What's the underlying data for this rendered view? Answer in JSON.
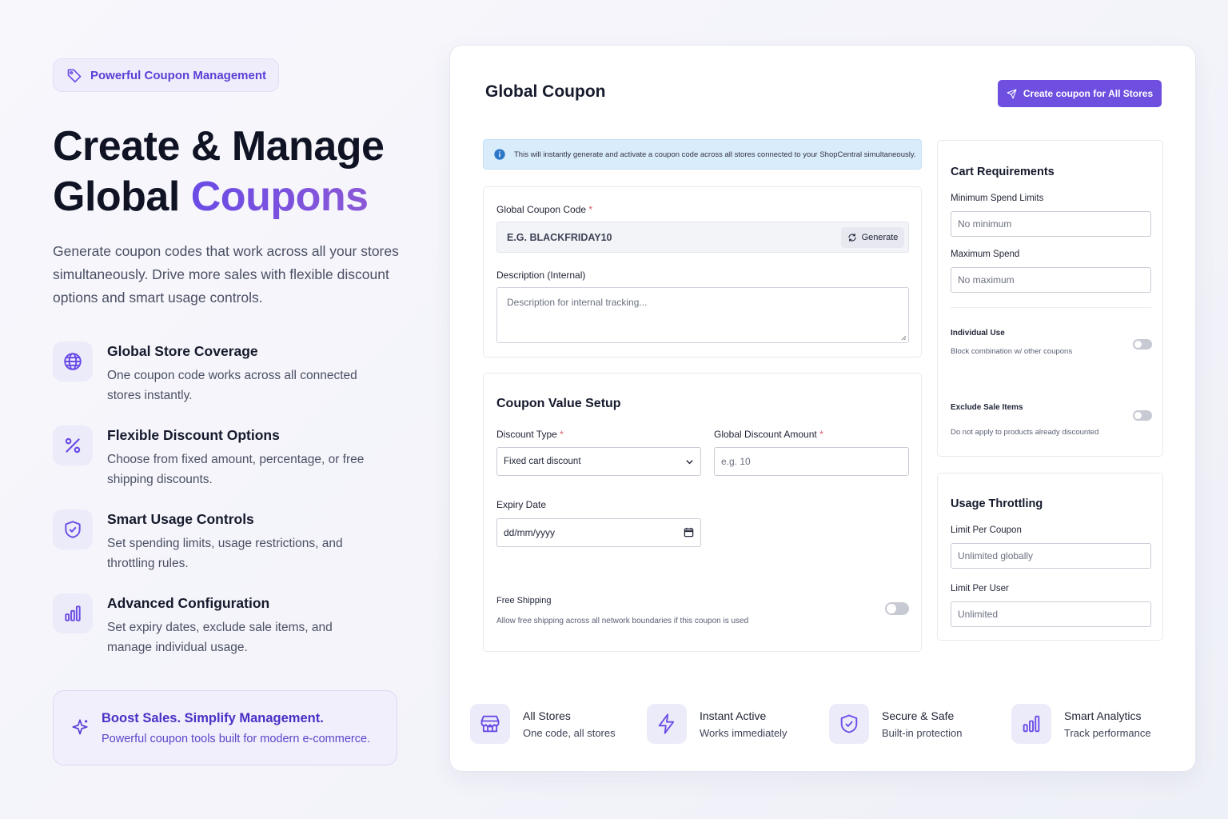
{
  "left": {
    "pill": "Powerful Coupon Management",
    "hero_line1": "Create & Manage",
    "hero_line2_plain": "Global ",
    "hero_line2_accent": "Coupons",
    "lead": "Generate coupon codes that work across all your stores simultaneously. Drive more sales with flexible discount options and smart usage controls.",
    "features": [
      {
        "icon": "globe-icon",
        "title": "Global Store Coverage",
        "desc": "One coupon code works across all connected stores instantly."
      },
      {
        "icon": "percent-icon",
        "title": "Flexible Discount Options",
        "desc": "Choose from fixed amount, percentage, or free shipping discounts."
      },
      {
        "icon": "shield-check-icon",
        "title": "Smart Usage Controls",
        "desc": "Set spending limits, usage restrictions, and throttling rules."
      },
      {
        "icon": "bar-chart-icon",
        "title": "Advanced Configuration",
        "desc": "Set expiry dates, exclude sale items, and manage individual usage."
      }
    ],
    "boost_title": "Boost Sales. Simplify Management.",
    "boost_sub": "Powerful coupon tools built for modern e-commerce."
  },
  "card": {
    "title": "Global Coupon",
    "create_button": "Create coupon for All Stores",
    "info": "This will instantly generate and activate a coupon code across all stores connected to your ShopCentral simultaneously.",
    "coupon_code_label": "Global Coupon Code",
    "coupon_code_placeholder": "E.G. BLACKFRIDAY10",
    "generate_button": "Generate",
    "description_label": "Description (Internal)",
    "description_placeholder": "Description for internal tracking...",
    "value_setup_title": "Coupon Value Setup",
    "discount_type_label": "Discount Type",
    "discount_type_value": "Fixed cart discount",
    "discount_amount_label": "Global Discount Amount",
    "discount_amount_placeholder": "e.g. 10",
    "expiry_label": "Expiry Date",
    "expiry_placeholder": "dd/mm/yyyy",
    "free_shipping_title": "Free Shipping",
    "free_shipping_desc": "Allow free shipping across all network boundaries if this coupon is used",
    "required_mark": "*"
  },
  "cart": {
    "title": "Cart Requirements",
    "min_label": "Minimum Spend Limits",
    "min_placeholder": "No minimum",
    "max_label": "Maximum Spend",
    "max_placeholder": "No maximum",
    "individual_title": "Individual Use",
    "individual_desc": "Block combination w/ other coupons",
    "exclude_title": "Exclude Sale Items",
    "exclude_desc": "Do not apply to products already discounted"
  },
  "usage": {
    "title": "Usage Throttling",
    "per_coupon_label": "Limit Per Coupon",
    "per_coupon_placeholder": "Unlimited globally",
    "per_user_label": "Limit Per User",
    "per_user_placeholder": "Unlimited"
  },
  "bottom": [
    {
      "icon": "store-icon",
      "title": "All Stores",
      "sub": "One code, all stores"
    },
    {
      "icon": "lightning-icon",
      "title": "Instant Active",
      "sub": "Works immediately"
    },
    {
      "icon": "shield-check-icon",
      "title": "Secure & Safe",
      "sub": "Built-in protection"
    },
    {
      "icon": "bar-chart-icon",
      "title": "Smart Analytics",
      "sub": "Track performance"
    }
  ],
  "colors": {
    "accent": "#6e4fe0",
    "accent_text": "#5b3fd6",
    "info_bg": "#d8ecfb",
    "icon_bg": "#ecebf9"
  }
}
